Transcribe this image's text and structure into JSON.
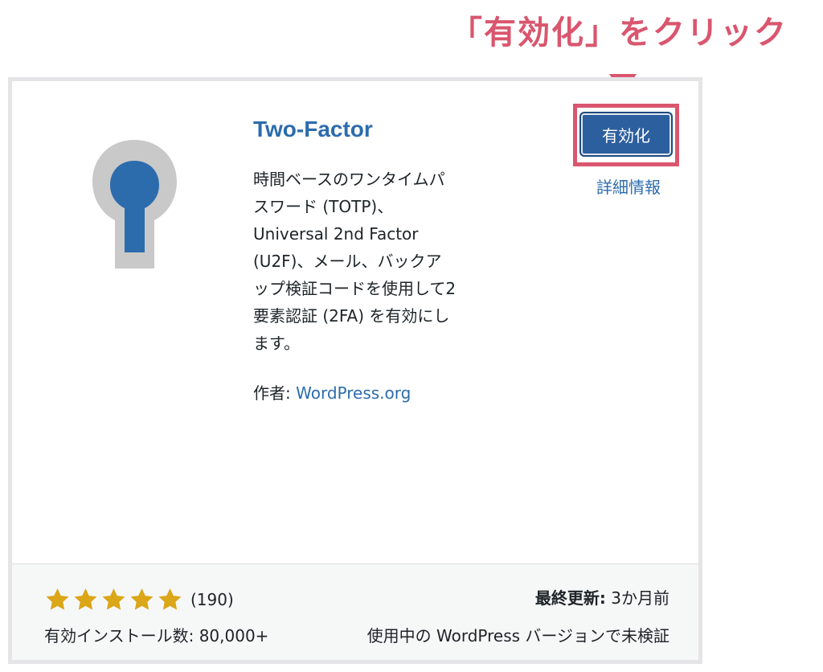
{
  "annotation": {
    "text": "「有効化」をクリック",
    "color": "#d9566e"
  },
  "plugin": {
    "icon": "keyhole-icon",
    "title": "Two-Factor",
    "description": "時間ベースのワンタイムパスワード (TOTP)、Universal 2nd Factor (U2F)、メール、バックアップ検証コードを使用して2要素認証 (2FA) を有効にします。",
    "description_lines": [
      "時間ベースのワンタイムパ",
      "スワード (TOTP)、",
      "Universal 2nd Factor",
      "(U2F)、メール、バックア",
      "ップ検証コードを使用して2",
      "要素認証 (2FA) を有効にし",
      "ます。"
    ],
    "author_label": "作者:",
    "author_name": "WordPress.org",
    "activate_label": "有効化",
    "details_label": "詳細情報"
  },
  "footer": {
    "rating_stars": 5,
    "rating_count": "(190)",
    "last_updated_label": "最終更新:",
    "last_updated_value": "3か月前",
    "installs": "有効インストール数: 80,000+",
    "compatibility": "使用中の WordPress バージョンで未検証"
  },
  "colors": {
    "accent": "#2c6cad",
    "button": "#2c5f9e",
    "star": "#dba617",
    "highlight": "#d9566e"
  }
}
